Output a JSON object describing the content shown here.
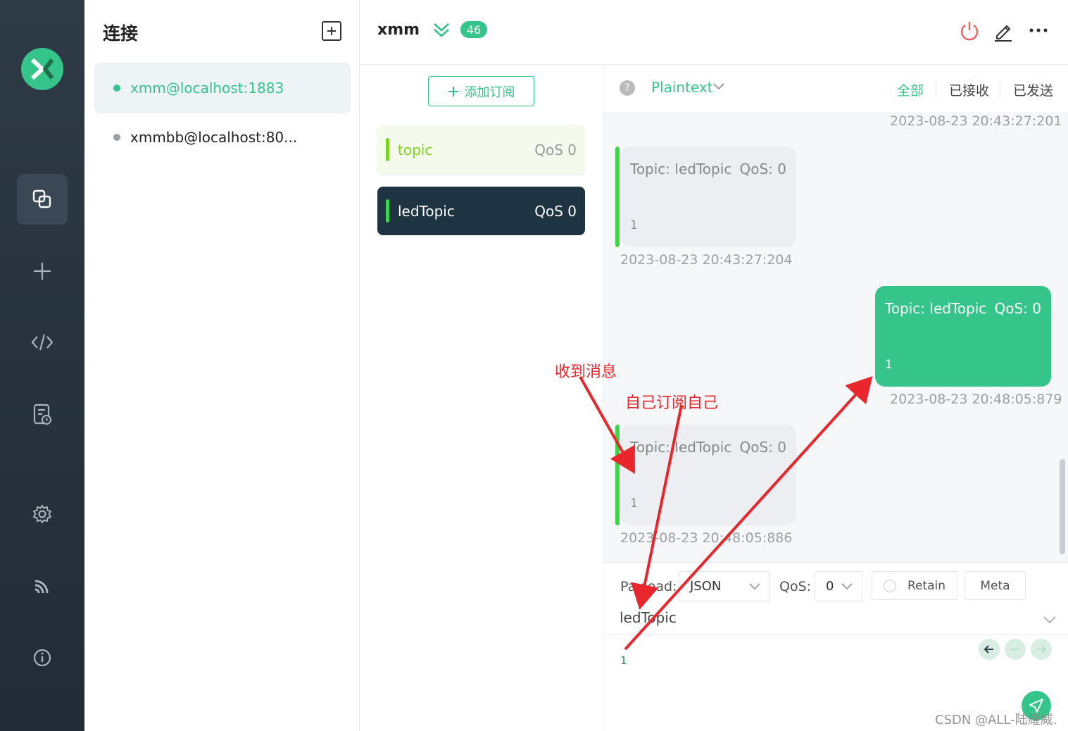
{
  "nav": {
    "items": [
      "connections-icon",
      "plus-icon",
      "code-icon",
      "log-icon",
      "gear-icon",
      "rss-icon",
      "info-icon"
    ]
  },
  "connections": {
    "title": "连接",
    "items": [
      {
        "label": "xmm@localhost:1883",
        "status_color": "#35c48a"
      },
      {
        "label": "xmmbb@localhost:80...",
        "status_color": "#9aa0a6"
      }
    ]
  },
  "header": {
    "name": "xmm",
    "badge": "46"
  },
  "subscriptions": {
    "add_label": "添加订阅",
    "items": [
      {
        "topic": "topic",
        "qos": "QoS 0",
        "color": "#7ed321"
      },
      {
        "topic": "ledTopic",
        "qos": "QoS 0",
        "color": "#3dd44a"
      }
    ]
  },
  "messages": {
    "format": "Plaintext",
    "help": "?",
    "filters": [
      "全部",
      "已接收",
      "已发送"
    ],
    "top_timestamp": "2023-08-23 20:43:27:201",
    "list": [
      {
        "direction": "in",
        "topic": "Topic: ledTopic",
        "qos": "QoS: 0",
        "payload": "1",
        "time": "2023-08-23 20:43:27:204"
      },
      {
        "direction": "out",
        "topic": "Topic: ledTopic",
        "qos": "QoS: 0",
        "payload": "1",
        "time": "2023-08-23 20:48:05:879"
      },
      {
        "direction": "in",
        "topic": "Topic: ledTopic",
        "qos": "QoS: 0",
        "payload": "1",
        "time": "2023-08-23 20:48:05:886"
      }
    ]
  },
  "publish": {
    "payload_label": "Payload:",
    "payload_format": "JSON",
    "qos_label": "QoS:",
    "qos_value": "0",
    "retain_label": "Retain",
    "meta_label": "Meta",
    "topic": "ledTopic",
    "payload": "1"
  },
  "annotations": {
    "received": "收到消息",
    "self_subscribe": "自己订阅自己"
  },
  "watermark": "CSDN @ALL-陆耀威."
}
